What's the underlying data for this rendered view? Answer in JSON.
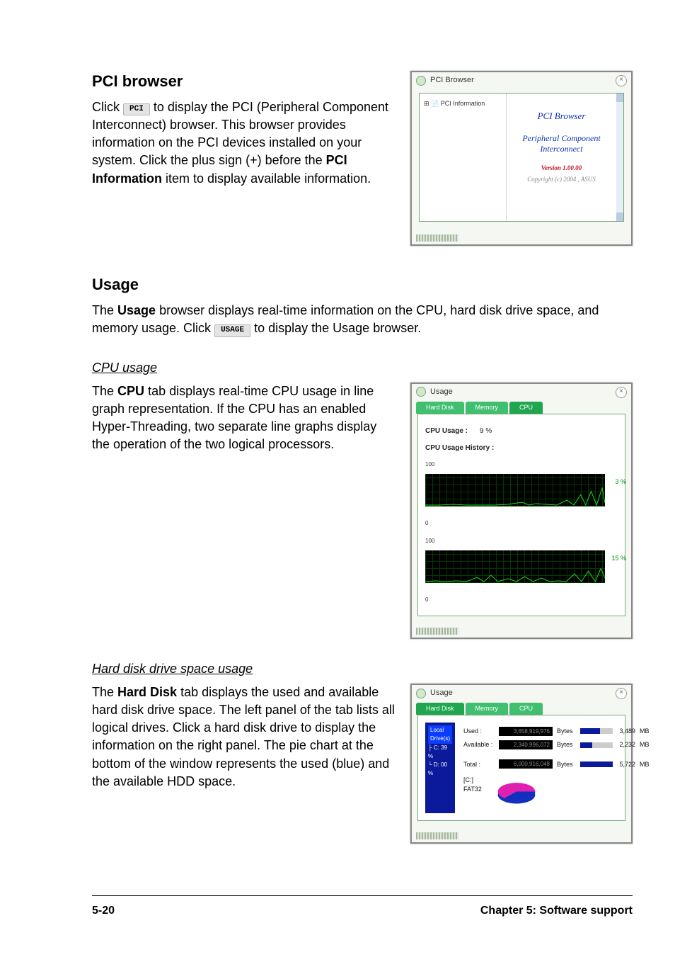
{
  "s1": {
    "heading": "PCI browser",
    "p1_a": "Click ",
    "p1_btn": "PCI",
    "p1_b": " to display the PCI (Peripheral Component Interconnect) browser. This browser provides information on the PCI devices installed on your system. Click the plus sign (+) before the ",
    "p1_bold": "PCI Information",
    "p1_c": " item to display available information."
  },
  "fig_pci": {
    "title": "PCI Browser",
    "tree_node": "PCI Information",
    "content_title": "PCI  Browser",
    "content_sub1": "Peripheral Component",
    "content_sub2": "Interconnect",
    "version": "Version 1.00.00",
    "copyright": "Copyright (c) 2004 ,  ASUS"
  },
  "s2": {
    "heading": "Usage",
    "p1_a": "The ",
    "p1_bold": "Usage",
    "p1_b": " browser displays real-time information on the CPU, hard disk drive space, and memory usage. Click ",
    "p1_btn": "USAGE",
    "p1_c": " to display the Usage browser."
  },
  "s2a": {
    "subhead": "CPU usage",
    "p1_a": "The ",
    "p1_bold": "CPU",
    "p1_b": " tab displays real-time CPU usage in line graph representation. If the CPU has an enabled Hyper-Threading, two separate line graphs display the operation of the two logical processors."
  },
  "fig_cpu": {
    "title": "Usage",
    "tab1": "Hard Disk",
    "tab2": "Memory",
    "tab3": "CPU",
    "usage_label": "CPU Usage :",
    "usage_value": "9   %",
    "history_label": "CPU Usage History :",
    "y100": "100",
    "y0": "0",
    "pct1": "3  %",
    "pct2": "15  %"
  },
  "s2b": {
    "subhead": "Hard disk drive space usage",
    "p1_a": "The ",
    "p1_bold": "Hard Disk",
    "p1_b": " tab displays the used and available hard disk drive space. The left panel of the tab lists all logical drives. Click a hard disk drive to display the information on the right panel. The pie chart at the bottom of the window represents the used (blue) and the available HDD space."
  },
  "fig_hd": {
    "title": "Usage",
    "tab1": "Hard Disk",
    "tab2": "Memory",
    "tab3": "CPU",
    "left_root": "Local Drive(s)",
    "left_c": "C:  39 %",
    "left_d": "D:  00 %",
    "used_label": "Used :",
    "used_bytes": "3,658,919,976",
    "used_unit": "Bytes",
    "used_mb": "3,489",
    "used_mb_unit": "MB",
    "avail_label": "Available :",
    "avail_bytes": "2,340,996,072",
    "avail_unit": "Bytes",
    "avail_mb": "2,232",
    "avail_mb_unit": "MB",
    "total_label": "Total :",
    "total_bytes": "6,000,916,048",
    "total_unit": "Bytes",
    "total_mb": "5,722",
    "total_mb_unit": "MB",
    "drive_id": "[C:]",
    "fs": "FAT32"
  },
  "footer": {
    "page": "5-20",
    "chapter": "Chapter 5: Software support"
  }
}
